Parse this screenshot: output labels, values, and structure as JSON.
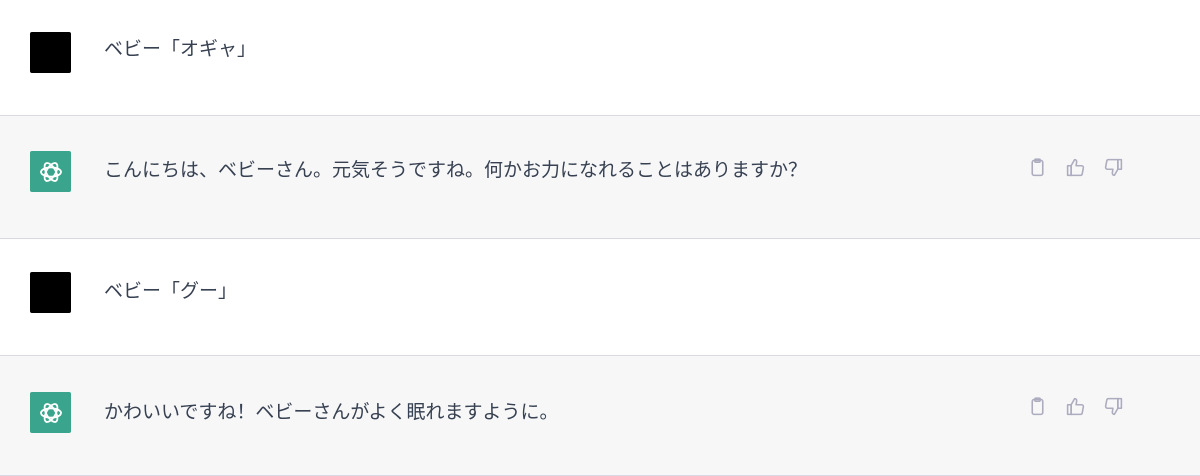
{
  "messages": [
    {
      "role": "user",
      "text": "ベビー「オギャ」"
    },
    {
      "role": "assistant",
      "text": "こんにちは、ベビーさん。元気そうですね。何かお力になれることはありますか？"
    },
    {
      "role": "user",
      "text": "ベビー「グー」"
    },
    {
      "role": "assistant",
      "text": "かわいいですね！ベビーさんがよく眠れますように。"
    }
  ],
  "colors": {
    "assistant_bg": "#f7f7f8",
    "bot_avatar": "#3aa58c",
    "user_avatar": "#000000",
    "text": "#374151",
    "icon": "#acacbe"
  },
  "icons": {
    "bot_avatar": "openai-logo-icon",
    "copy": "clipboard-icon",
    "like": "thumbs-up-icon",
    "dislike": "thumbs-down-icon"
  }
}
